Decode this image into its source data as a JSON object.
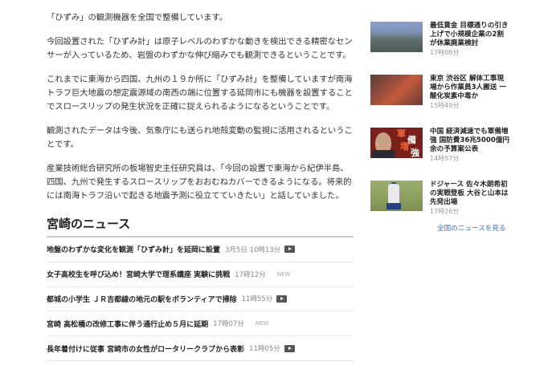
{
  "article": {
    "paragraphs": [
      "「ひずみ」の観測機器を全国で整備しています。",
      "今回設置された「ひずみ計」は原子レベルのわずかな動きを検出できる精密なセンサーが入っているため、岩盤のわずかな伸び縮みでも観測できるということです。",
      "これまでに東海から四国、九州の１９か所に「ひずみ計」を整備していますが南海トラフ巨大地震の想定震源域の南西の端に位置する延岡市にも機器を設置することでスロースリップの発生状況を正確に捉えられるようになるということです。",
      "観測されたデータは今後、気象庁にも送られ地殻変動の監視に活用されるということです。",
      "産業技術総合研究所の板場智史主任研究員は、「今回の設置で東海から紀伊半島、四国、九州で発生するスロースリップをおおむねカバーできるようになる。将来的には南海トラフ沿いで起きる地震予測に役立てていきたい」と話していました。"
    ]
  },
  "local_news": {
    "heading": "宮崎のニュース",
    "items": [
      {
        "title": "地盤のわずかな変化を観測「ひずみ計」を延岡に設置",
        "time": "3月5日 10時13分",
        "video": true,
        "new": ""
      },
      {
        "title": "女子高校生を呼び込め！宮崎大学で理系講座 実験に挑戦",
        "time": "17時12分",
        "video": false,
        "new": "NEW"
      },
      {
        "title": "都城の小学生 ＪＲ吉都線の地元の駅をボランティアで掃除",
        "time": "11時55分",
        "video": true,
        "new": ""
      },
      {
        "title": "宮崎 高松橋の改修工事に伴う通行止め５月に延期",
        "time": "17時07分",
        "video": false,
        "new": "NEW"
      },
      {
        "title": "長年着付けに従事 宮崎市の女性がロータリークラブから表彰",
        "time": "11時05分",
        "video": true,
        "new": ""
      }
    ]
  },
  "sidebar": {
    "items": [
      {
        "title": "最低賃金 目標通りの引き上げで小規模企業の2割が休業廃業検討",
        "time": "17時08分",
        "thumb": "city-aerial"
      },
      {
        "title": "東京 渋谷区 解体工事現場から作業員3人搬送 一酸化炭素中毒か",
        "time": "15時49分",
        "thumb": "fire-trucks"
      },
      {
        "title": "中国 経済減速でも軍備増強 国防費36兆5000億円余の予算案公表",
        "time": "14時57分",
        "thumb": "official-portrait",
        "overlay": [
          "軍",
          "備",
          "増",
          "強"
        ]
      },
      {
        "title": "ドジャース 佐々木朗希初の実戦登板 大谷と山本は先発出場",
        "time": "17時26分",
        "thumb": "baseball-pitcher"
      }
    ],
    "see_all": "全国のニュースを見る"
  },
  "colors": {
    "link": "#3a6fc4",
    "divider": "#cccccc",
    "new_badge": "#aaaaaa"
  }
}
